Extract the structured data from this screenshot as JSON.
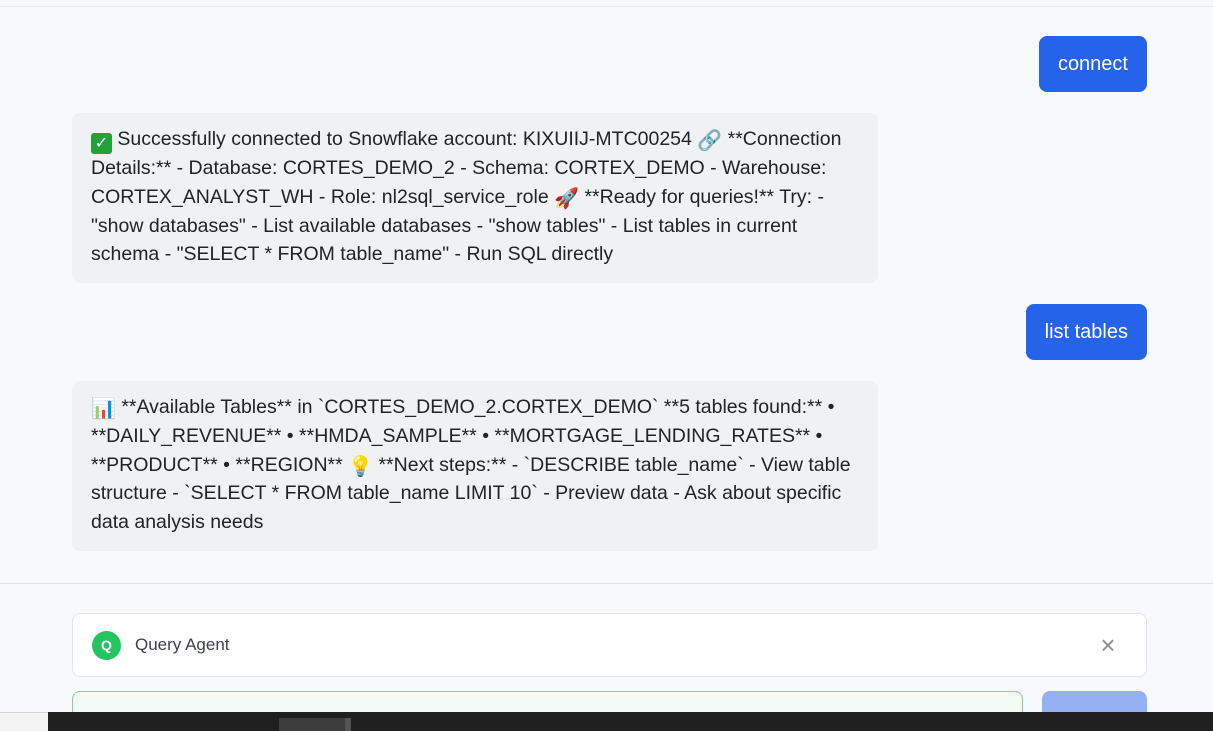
{
  "messages": [
    {
      "role": "user",
      "text": "connect"
    },
    {
      "role": "assistant",
      "text_a": "Successfully connected to Snowflake account: KIXUIIJ-MTC00254",
      "text_b": "**Connection Details:** - Database: CORTES_DEMO_2 - Schema: CORTEX_DEMO - Warehouse: CORTEX_ANALYST_WH - Role: nl2sql_service_role",
      "text_c": "**Ready for queries!** Try: - \"show databases\" - List available databases - \"show tables\" - List tables in current schema - \"SELECT * FROM table_name\" - Run SQL directly"
    },
    {
      "role": "user",
      "text": "list tables"
    },
    {
      "role": "assistant",
      "text_a": "**Available Tables** in `CORTES_DEMO_2.CORTEX_DEMO` **5 tables found:** • **DAILY_REVENUE** • **HMDA_SAMPLE** • **MORTGAGE_LENDING_RATES** • **PRODUCT** • **REGION**",
      "text_b": "**Next steps:** - `DESCRIBE table_name` - View table structure - `SELECT * FROM table_name LIMIT 10` - Preview data - Ask about specific data analysis needs"
    }
  ],
  "emojis": {
    "check": "✓",
    "link": "🔗",
    "rocket": "🚀",
    "chart": "📊",
    "bulb": "💡"
  },
  "agent": {
    "avatar_letter": "Q",
    "label": "Query Agent",
    "close": "×"
  },
  "input": {
    "value": ""
  },
  "colors": {
    "user_bubble": "#2563eb",
    "assistant_bubble": "#f0f1f3",
    "agent_avatar": "#22c55e",
    "input_border": "#7fd39a",
    "send_button": "#93b1f3"
  },
  "icons": [
    "check-emoji-icon",
    "link-emoji-icon",
    "rocket-emoji-icon",
    "chart-emoji-icon",
    "bulb-emoji-icon",
    "close-icon"
  ]
}
